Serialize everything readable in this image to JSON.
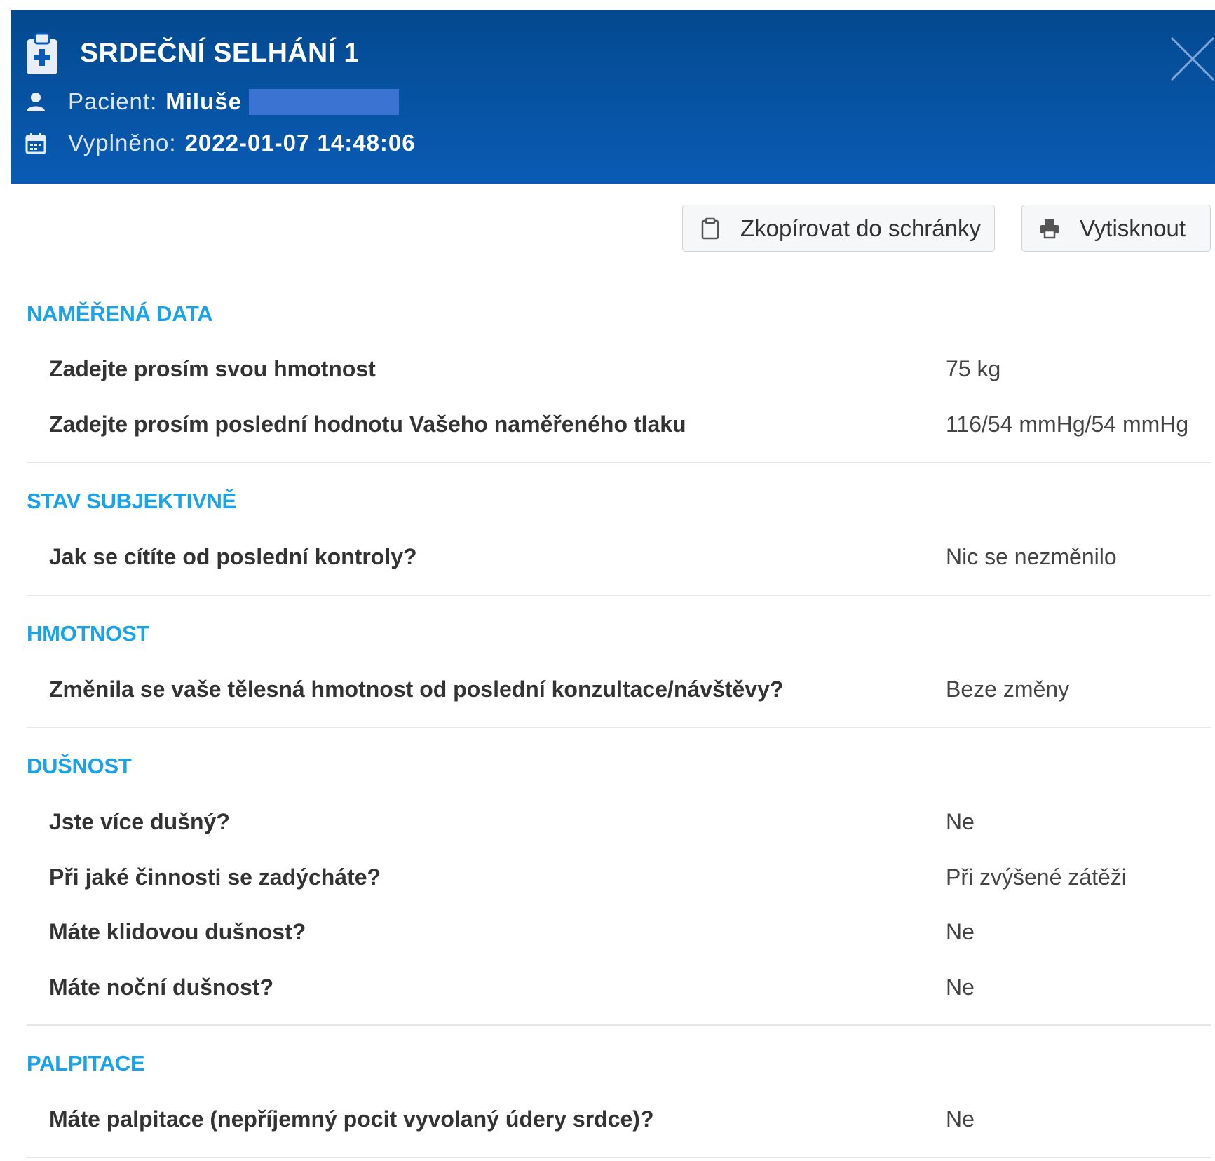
{
  "header": {
    "title": "SRDEČNÍ SELHÁNÍ 1",
    "patient_label": "Pacient:",
    "patient_name": "Miluše",
    "filled_label": "Vyplněno:",
    "filled_value": "2022-01-07 14:48:06",
    "icons": {
      "title": "clipboard-medical-icon",
      "patient": "user-icon",
      "filled": "calendar-icon",
      "close": "close-icon"
    }
  },
  "toolbar": {
    "copy_label": "Zkopírovat do schránky",
    "print_label": "Vytisknout"
  },
  "sections": [
    {
      "title": "NAMĚŘENÁ DATA",
      "rows": [
        {
          "q": "Zadejte prosím svou hmotnost",
          "a": "75 kg"
        },
        {
          "q": "Zadejte prosím poslední hodnotu Vašeho naměřeného tlaku",
          "a": "116/54 mmHg/54 mmHg"
        }
      ]
    },
    {
      "title": "STAV SUBJEKTIVNĚ",
      "rows": [
        {
          "q": "Jak se cítíte od poslední kontroly?",
          "a": "Nic se nezměnilo"
        }
      ]
    },
    {
      "title": "HMOTNOST",
      "rows": [
        {
          "q": "Změnila se vaše tělesná hmotnost od poslední konzultace/návštěvy?",
          "a": "Beze změny"
        }
      ]
    },
    {
      "title": "DUŠNOST",
      "rows": [
        {
          "q": "Jste více dušný?",
          "a": "Ne"
        },
        {
          "q": "Při jaké činnosti se zadýcháte?",
          "a": "Při zvýšené zátěži"
        },
        {
          "q": "Máte klidovou dušnost?",
          "a": "Ne"
        },
        {
          "q": "Máte noční dušnost?",
          "a": "Ne"
        }
      ]
    },
    {
      "title": "PALPITACE",
      "rows": [
        {
          "q": "Máte palpitace (nepříjemný pocit vyvolaný údery srdce)?",
          "a": "Ne"
        }
      ]
    }
  ],
  "colors": {
    "header_bg": "#0a5bb5",
    "section_title": "#1aa3e8",
    "redaction": "#3b73d3"
  }
}
